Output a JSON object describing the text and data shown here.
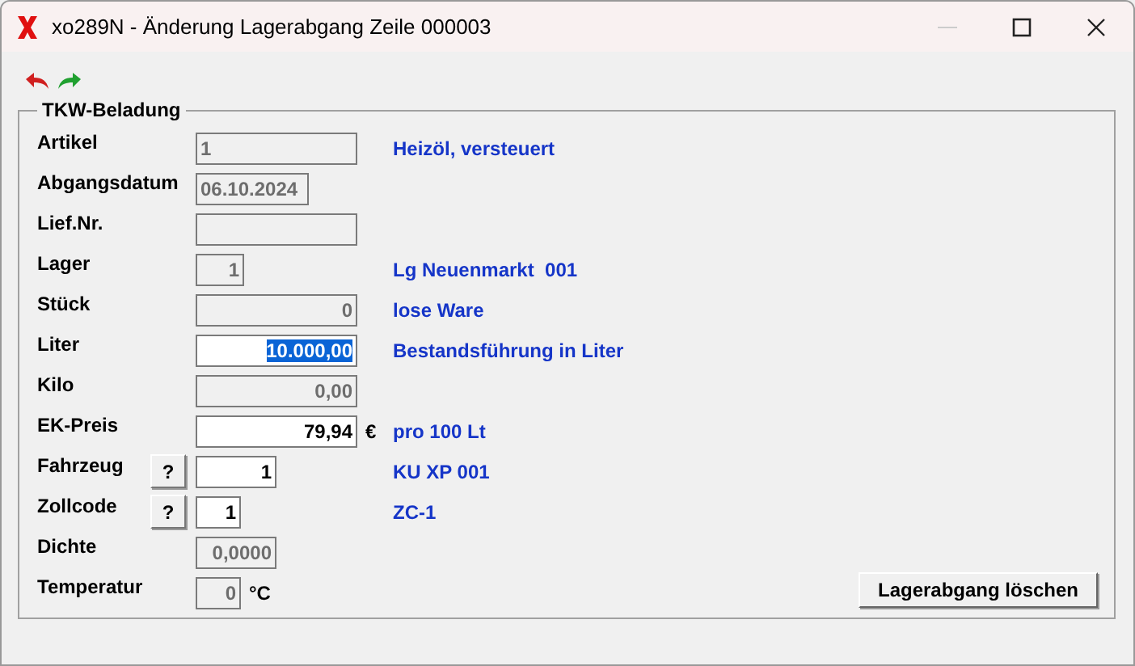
{
  "window": {
    "title": "xo289N - Änderung Lagerabgang Zeile 000003"
  },
  "group": {
    "title": "TKW-Beladung"
  },
  "rows": [
    {
      "label": "Artikel",
      "field": {
        "value": "1",
        "editable": false
      },
      "info": "Heizöl, versteuert"
    },
    {
      "label": "Abgangsdatum",
      "field": {
        "value": "06.10.2024",
        "editable": false
      }
    },
    {
      "label": "Lief.Nr.",
      "field": {
        "editable": false
      }
    },
    {
      "label": "Lager",
      "field": {
        "value": "1",
        "editable": false
      },
      "info": "Lg Neuenmarkt  001"
    },
    {
      "label": "Stück",
      "field": {
        "value": "0",
        "editable": false
      },
      "info": "lose Ware"
    },
    {
      "label": "Liter",
      "field": {
        "value": "10.000,00",
        "editable": true,
        "selected": true
      },
      "info": "Bestandsführung in Liter"
    },
    {
      "label": "Kilo",
      "field": {
        "value": "0,00",
        "editable": false
      }
    },
    {
      "label": "EK-Preis",
      "field": {
        "value": "79,94",
        "editable": true,
        "selected": false
      },
      "unit": "€",
      "info": "pro 100 Lt"
    },
    {
      "label": "Fahrzeug",
      "help": "?",
      "field": {
        "value": "1",
        "editable": true,
        "selected": false
      },
      "info": "KU XP 001"
    },
    {
      "label": "Zollcode",
      "help": "?",
      "field": {
        "value": "1",
        "editable": true,
        "selected": false
      },
      "info": "ZC-1"
    },
    {
      "label": "Dichte",
      "field": {
        "value": "0,0000",
        "editable": false
      }
    },
    {
      "label": "Temperatur",
      "field": {
        "value": "0",
        "editable": false
      },
      "unit": "°C"
    }
  ],
  "delete_button": {
    "label": "Lagerabgang löschen"
  }
}
